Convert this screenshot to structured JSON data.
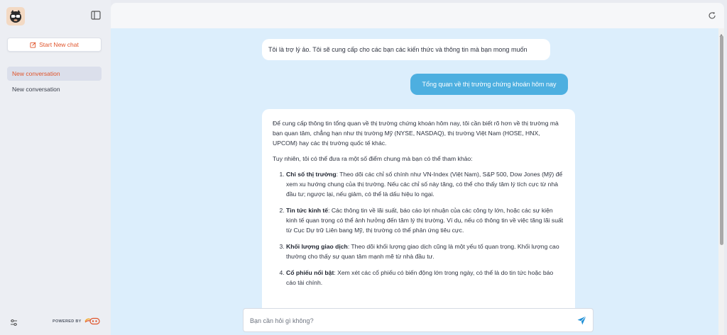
{
  "sidebar": {
    "new_chat_label": "Start New chat",
    "conversations": [
      {
        "label": "New conversation",
        "active": true
      },
      {
        "label": "New conversation",
        "active": false
      }
    ],
    "powered_by": "POWERED BY"
  },
  "chat": {
    "welcome": "Tôi là trợ lý ảo. Tôi sẽ cung cấp cho các bạn các kiến thức và thông tin mà bạn mong muốn",
    "user_message": "Tổng quan về thị trường chứng khoán hôm nay",
    "reply": {
      "intro": "Để cung cấp thông tin tổng quan về thị trường chứng khoán hôm nay, tôi cần biết rõ hơn về thị trường mà bạn quan tâm, chẳng hạn như thị trường Mỹ (NYSE, NASDAQ), thị trường Việt Nam (HOSE, HNX, UPCOM) hay các thị trường quốc tế khác.",
      "lead": "Tuy nhiên, tôi có thể đưa ra một số điểm chung mà bạn có thể tham khảo:",
      "items": [
        {
          "title": "Chỉ số thị trường",
          "text": ": Theo dõi các chỉ số chính như VN-Index (Việt Nam), S&P 500, Dow Jones (Mỹ) để xem xu hướng chung của thị trường. Nếu các chỉ số này tăng, có thể cho thấy tâm lý tích cực từ nhà đầu tư; ngược lại, nếu giảm, có thể là dấu hiệu lo ngại."
        },
        {
          "title": "Tin tức kinh tế",
          "text": ": Các thông tin về lãi suất, báo cáo lợi nhuận của các công ty lớn, hoặc các sự kiện kinh tế quan trọng có thể ảnh hưởng đến tâm lý thị trường. Ví dụ, nếu có thông tin về việc tăng lãi suất từ Cục Dự trữ Liên bang Mỹ, thị trường có thể phản ứng tiêu cực."
        },
        {
          "title": "Khối lượng giao dịch",
          "text": ": Theo dõi khối lượng giao dịch cũng là một yếu tố quan trọng. Khối lượng cao thường cho thấy sự quan tâm mạnh mẽ từ nhà đầu tư."
        },
        {
          "title": "Cổ phiếu nổi bật",
          "text": ": Xem xét các cổ phiếu có biến động lớn trong ngày, có thể là do tin tức hoặc báo cáo tài chính."
        }
      ]
    }
  },
  "input": {
    "placeholder": "Bạn cần hỏi gì không?",
    "value": ""
  },
  "colors": {
    "accent": "#e0542b",
    "user_bubble": "#4dafe0",
    "chat_bg": "#dceefc",
    "send_icon": "#1f8fd6"
  },
  "icons": [
    "logo-mascot-icon",
    "sidebar-toggle-icon",
    "edit-icon",
    "settings-sliders-icon",
    "brand-logo-icon",
    "refresh-icon",
    "send-icon"
  ]
}
